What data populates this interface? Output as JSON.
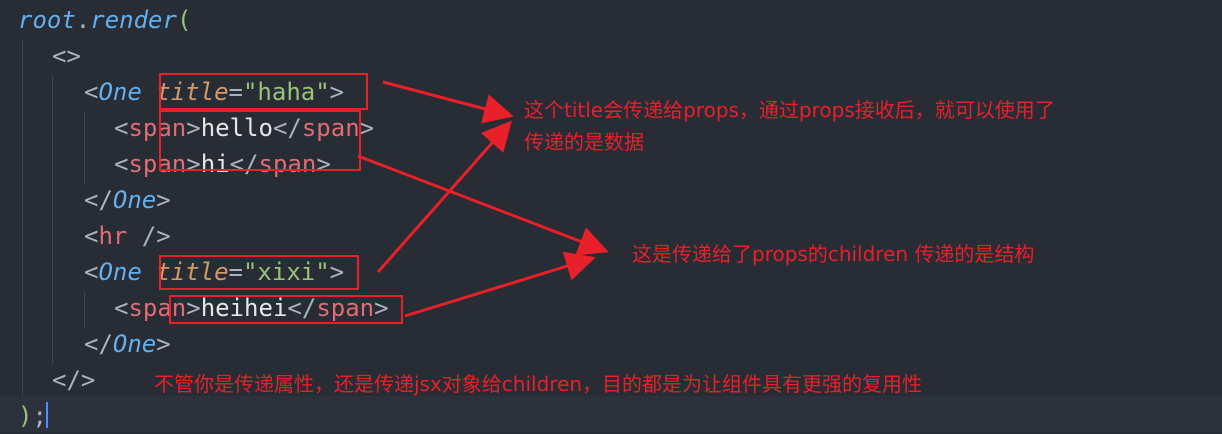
{
  "code_lines": [
    {
      "parts": [
        [
          "root",
          "kw-italic"
        ],
        [
          ".",
          "punct"
        ],
        [
          "render",
          "kw-italic"
        ],
        [
          "(",
          "brkt"
        ]
      ]
    },
    {
      "parts": [
        [
          "<>",
          "punct"
        ]
      ]
    },
    {
      "parts": [
        [
          "<",
          "punct"
        ],
        [
          "One",
          "comp"
        ],
        [
          " ",
          "txt"
        ],
        [
          "title",
          "attr"
        ],
        [
          "=",
          "punct"
        ],
        [
          "\"haha\"",
          "str"
        ],
        [
          ">",
          "punct"
        ]
      ]
    },
    {
      "parts": [
        [
          "<",
          "punct"
        ],
        [
          "span",
          "tag"
        ],
        [
          ">",
          "punct"
        ],
        [
          "hello",
          "txt"
        ],
        [
          "</",
          "punct"
        ],
        [
          "span",
          "tag"
        ],
        [
          ">",
          "punct"
        ]
      ]
    },
    {
      "parts": [
        [
          "<",
          "punct"
        ],
        [
          "span",
          "tag"
        ],
        [
          ">",
          "punct"
        ],
        [
          "hi",
          "txt"
        ],
        [
          "</",
          "punct"
        ],
        [
          "span",
          "tag"
        ],
        [
          ">",
          "punct"
        ]
      ]
    },
    {
      "parts": [
        [
          "</",
          "punct"
        ],
        [
          "One",
          "comp"
        ],
        [
          ">",
          "punct"
        ]
      ]
    },
    {
      "parts": [
        [
          "<",
          "punct"
        ],
        [
          "hr",
          "tag"
        ],
        [
          " />",
          "punct"
        ]
      ]
    },
    {
      "parts": [
        [
          "<",
          "punct"
        ],
        [
          "One",
          "comp"
        ],
        [
          " ",
          "txt"
        ],
        [
          "title",
          "attr"
        ],
        [
          "=",
          "punct"
        ],
        [
          "\"xixi\"",
          "str"
        ],
        [
          ">",
          "punct"
        ]
      ]
    },
    {
      "parts": [
        [
          "<",
          "punct"
        ],
        [
          "span",
          "tag"
        ],
        [
          ">",
          "punct"
        ],
        [
          "heihei",
          "txt"
        ],
        [
          "</",
          "punct"
        ],
        [
          "span",
          "tag"
        ],
        [
          ">",
          "punct"
        ]
      ]
    },
    {
      "parts": [
        [
          "</",
          "punct"
        ],
        [
          "One",
          "comp"
        ],
        [
          ">",
          "punct"
        ]
      ]
    },
    {
      "parts": [
        [
          "</>",
          "punct"
        ]
      ]
    },
    {
      "parts": [
        [
          ")",
          "brkt"
        ],
        [
          ";",
          "punct"
        ]
      ]
    }
  ],
  "annotations": {
    "props_note_line1": "这个title会传递给props，通过props接收后，就可以使用了",
    "props_note_line2": "传递的是数据",
    "children_note": "这是传递给了props的children    传递的是结构",
    "summary_note": "不管你是传递属性，还是传递jsx对象给children，目的都是为让组件具有更强的复用性"
  },
  "colors": {
    "background": "#282c34",
    "annotation_red": "#e8202a"
  }
}
